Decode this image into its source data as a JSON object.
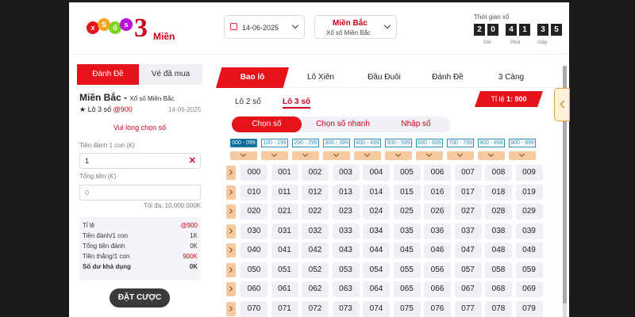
{
  "header": {
    "logo_text": "3",
    "logo_sub": "Miền",
    "logo_balls": [
      "x",
      "S",
      "ổ",
      "s"
    ],
    "date": "14-06-2025",
    "region_title": "Miền Bắc",
    "region_sub": "Xổ số Miền Bắc",
    "timer_label": "Thời gian xổ",
    "timer_digits": [
      "2",
      "0",
      "4",
      "1",
      "3",
      "5"
    ],
    "timer_units": [
      "Giờ",
      "Phút",
      "Giây"
    ]
  },
  "left": {
    "tabs": [
      "Đánh Đề",
      "Vé đã mua"
    ],
    "title": "Miền Bắc -",
    "title_sub": "Xổ số Miền Bắc",
    "bet_type": "★ Lô 3 số",
    "bet_odds": "@900",
    "date": "14-06-2025",
    "pick_msg": "Vui lòng chọn số",
    "unit_label": "Tiền đánh 1 con (K)",
    "unit_value": "1",
    "clear_symbol": "✕",
    "total_label": "Tổng tiền (K)",
    "total_value": "0",
    "max_text": "Tối đa: 10.000.000K",
    "summary": [
      {
        "label": "Tỉ lệ",
        "value": "@900",
        "red": true,
        "bold": false
      },
      {
        "label": "Tiền đánh/1 con",
        "value": "1K",
        "red": false,
        "bold": false
      },
      {
        "label": "Tổng tiền đánh",
        "value": "0K",
        "red": false,
        "bold": false
      },
      {
        "label": "Tiền thắng/1 con",
        "value": "900K",
        "red": true,
        "bold": false
      },
      {
        "label": "Số dư khả dụng",
        "value": "0K",
        "red": false,
        "bold": true
      }
    ],
    "bet_button": "ĐẶT CƯỢC"
  },
  "right": {
    "tabs": [
      "Bao lô",
      "Lô Xiên",
      "Đầu Đuôi",
      "Đánh Đề",
      "3 Càng"
    ],
    "subtabs": [
      "Lô 2 số",
      "Lô 3 số"
    ],
    "odds_label": "Tỉ lệ",
    "odds_value": "1: 900",
    "modes": [
      "Chọn số",
      "Chọn số nhanh",
      "Nhập số"
    ],
    "ranges": [
      "000 - 099",
      "100 - 199",
      "200 - 299",
      "300 - 399",
      "400 - 499",
      "500 - 599",
      "600 - 699",
      "700 - 799",
      "800 - 899",
      "900 - 999"
    ],
    "numbers": [
      [
        "000",
        "001",
        "002",
        "003",
        "004",
        "005",
        "006",
        "007",
        "008",
        "009"
      ],
      [
        "010",
        "011",
        "012",
        "013",
        "014",
        "015",
        "016",
        "017",
        "018",
        "019"
      ],
      [
        "020",
        "021",
        "022",
        "023",
        "024",
        "025",
        "026",
        "027",
        "028",
        "029"
      ],
      [
        "030",
        "031",
        "032",
        "033",
        "034",
        "035",
        "036",
        "037",
        "038",
        "039"
      ],
      [
        "040",
        "041",
        "042",
        "043",
        "044",
        "045",
        "046",
        "047",
        "048",
        "049"
      ],
      [
        "050",
        "051",
        "052",
        "053",
        "054",
        "055",
        "056",
        "057",
        "058",
        "059"
      ],
      [
        "060",
        "061",
        "062",
        "063",
        "064",
        "065",
        "066",
        "067",
        "068",
        "069"
      ],
      [
        "070",
        "071",
        "072",
        "073",
        "074",
        "075",
        "076",
        "077",
        "078",
        "079"
      ]
    ]
  },
  "colors": {
    "accent": "#e8121b",
    "range_blue": "#2a8fb8",
    "chevron_bg": "#f7c9a0"
  }
}
